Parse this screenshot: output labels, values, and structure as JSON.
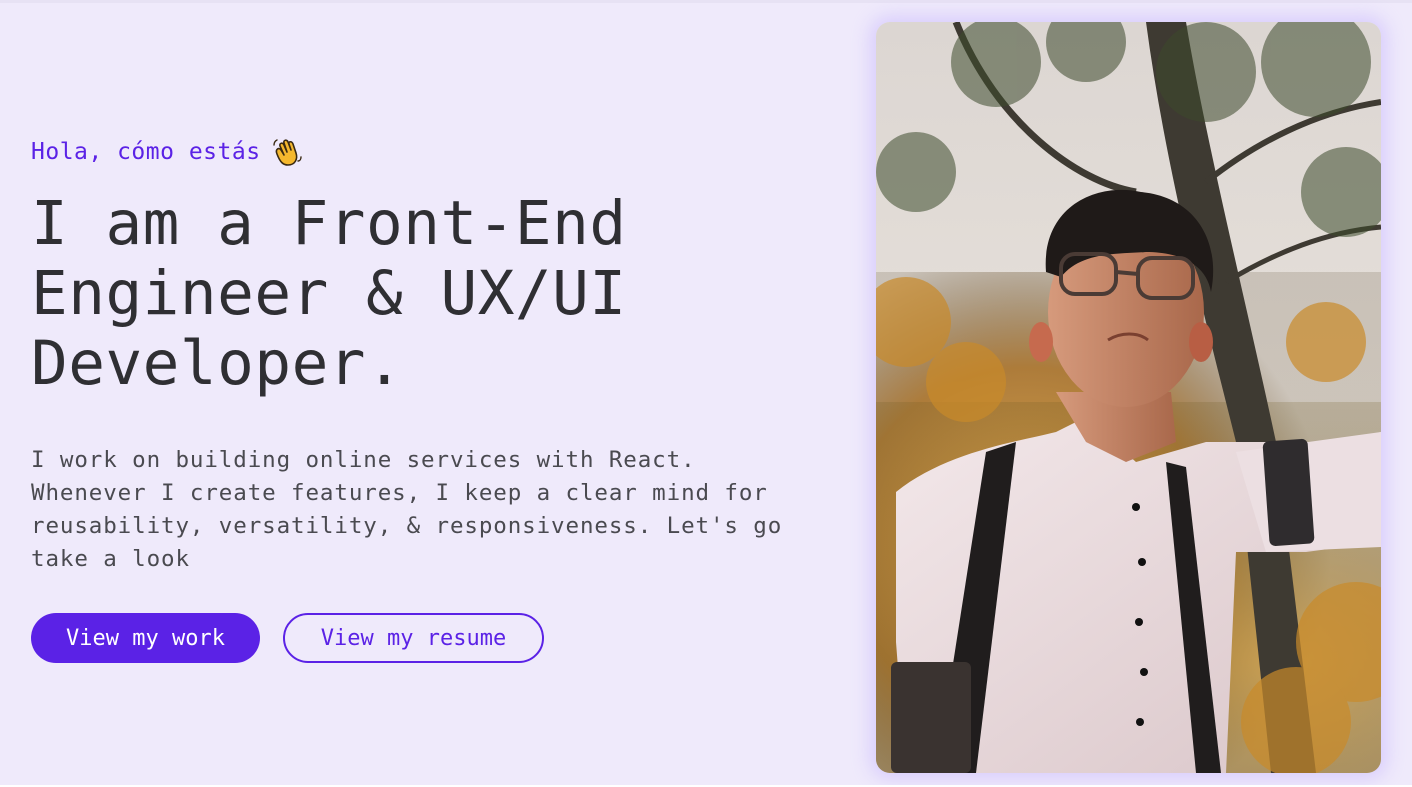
{
  "hero": {
    "greeting": "Hola, cómo estás",
    "greeting_emoji": "waving-hand-icon",
    "headline": "I am a Front-End Engineer & UX/UI Developer.",
    "intro": "I work on building online services with React. Whenever I create features, I keep a clear mind for reusability, versatility, & responsiveness. Let's go take a look"
  },
  "actions": {
    "primary_label": "View my work",
    "secondary_label": "View my resume"
  },
  "photo": {
    "subject": "portrait-photo"
  },
  "colors": {
    "accent": "#5b22e6",
    "background": "#efeafb",
    "heading": "#2f2f33",
    "body_text": "#4a4a50"
  }
}
